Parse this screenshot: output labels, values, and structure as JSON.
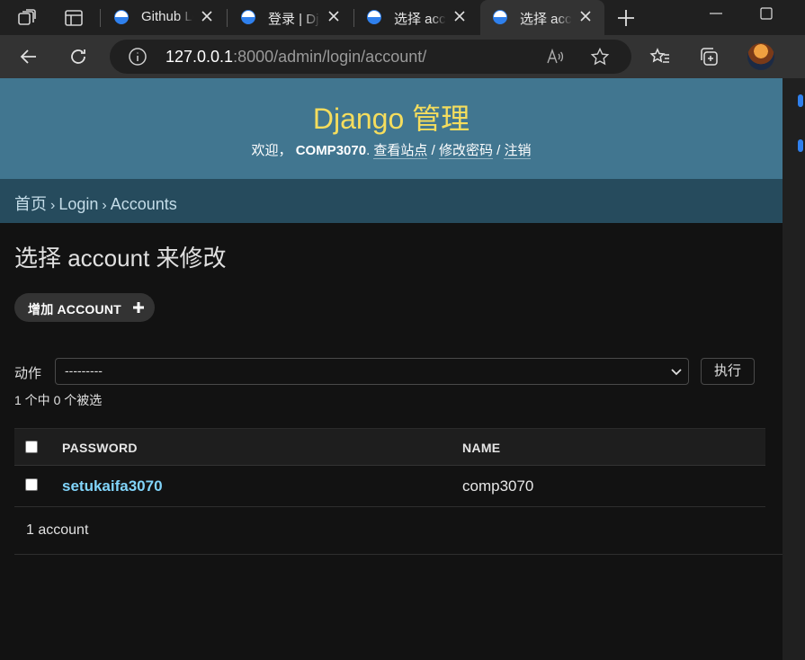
{
  "browser": {
    "tabs": [
      {
        "label": "Github Lo",
        "active": false
      },
      {
        "label": "登录 | Dja",
        "active": false
      },
      {
        "label": "选择 acco",
        "active": false
      },
      {
        "label": "选择 acco",
        "active": true
      }
    ],
    "url_host": "127.0.0.1",
    "url_rest": ":8000/admin/login/account/"
  },
  "header": {
    "branding": "Django 管理",
    "welcome": "欢迎，",
    "username": "COMP3070",
    "view_site": "查看站点",
    "change_password": "修改密码",
    "logout": "注销",
    "dot": ".",
    "slash": "/"
  },
  "breadcrumbs": {
    "home": "首页",
    "app": "Login",
    "model": "Accounts",
    "separator": "›"
  },
  "content": {
    "title": "选择 account 来修改",
    "add_button": "增加 ACCOUNT",
    "actions_label": "动作",
    "action_selected": "---------",
    "go_button": "执行",
    "selection_counter": "1 个中 0 个被选"
  },
  "table": {
    "columns": [
      "PASSWORD",
      "NAME"
    ],
    "rows": [
      {
        "password": "setukaifa3070",
        "name": "comp3070"
      }
    ]
  },
  "paginator": "1 account",
  "colors": {
    "header_bg": "#417690",
    "branding": "#f5dd5d",
    "breadcrumbs_bg": "#264b5d",
    "link": "#81d4fa",
    "page_bg": "#121212"
  }
}
